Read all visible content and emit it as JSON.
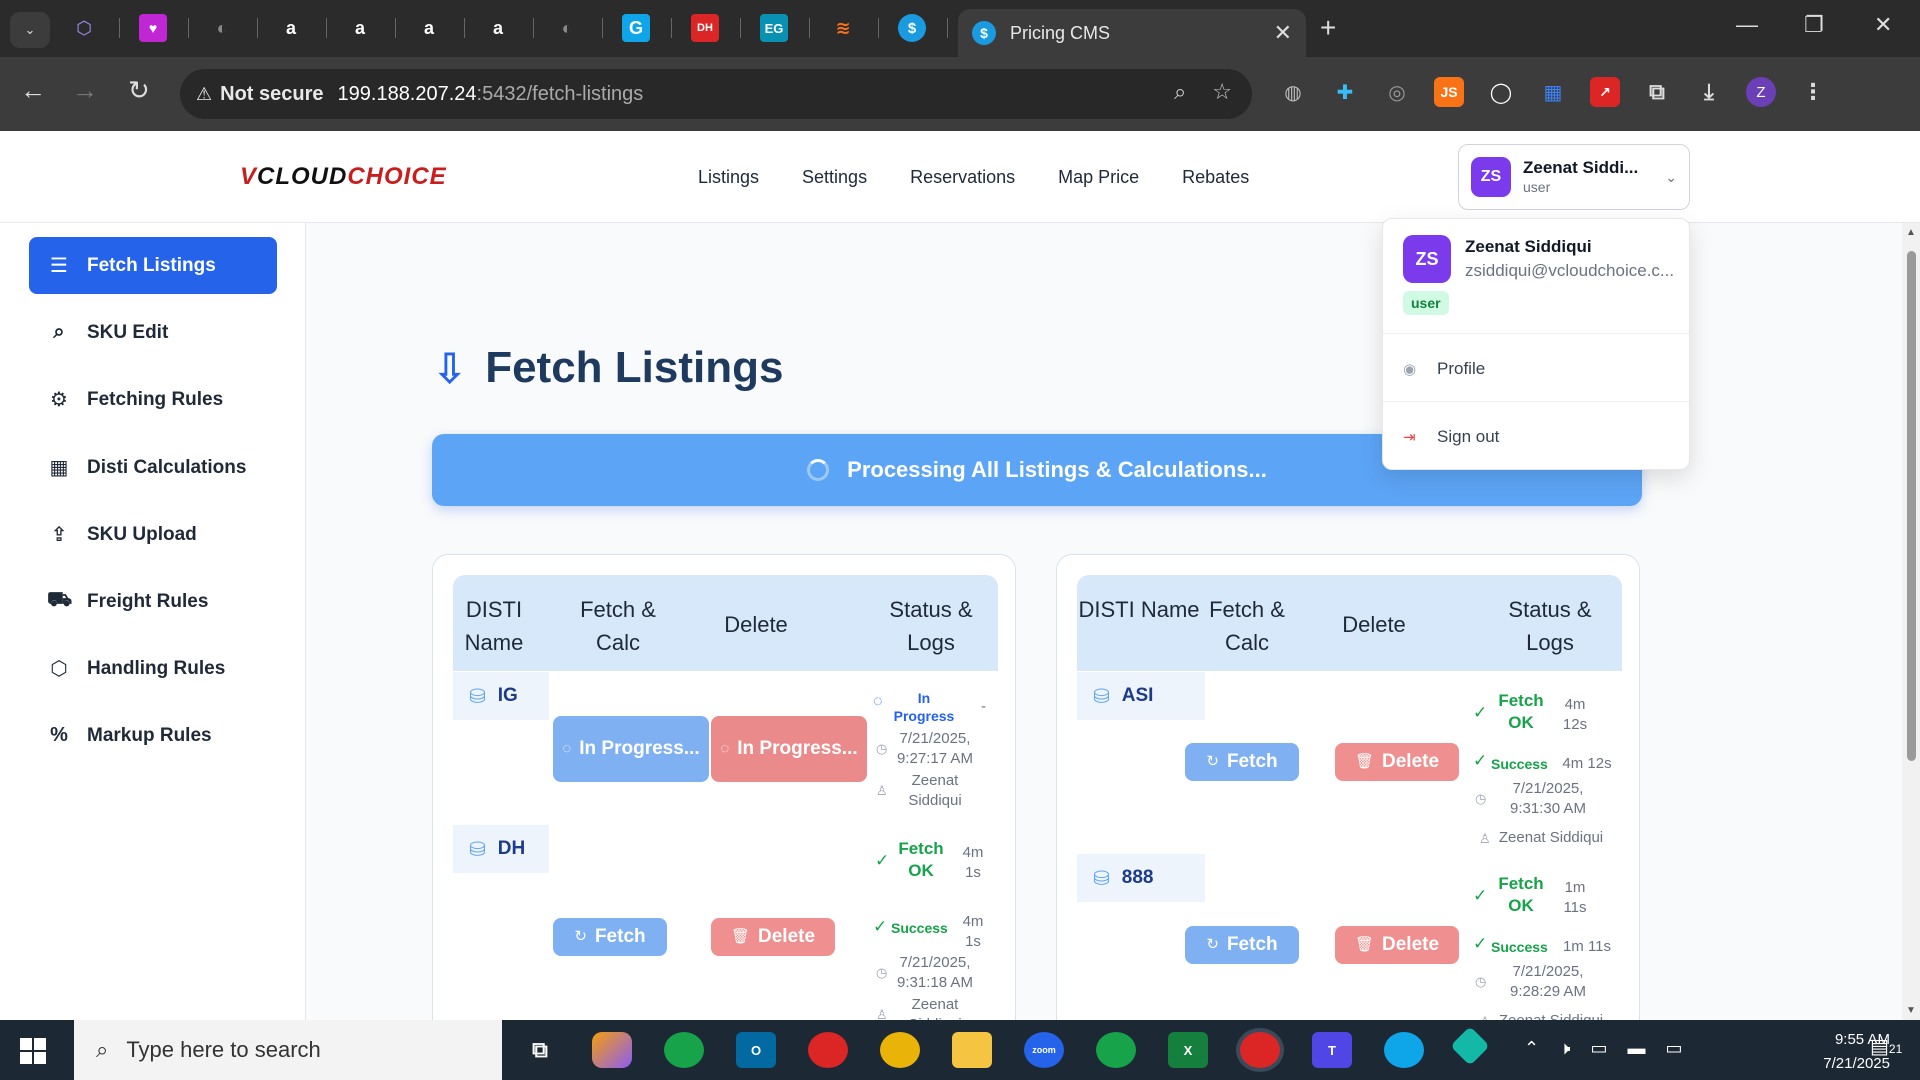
{
  "browser": {
    "pinned_tabs": [
      "⬡",
      "♥",
      "◐",
      "a",
      "a",
      "a",
      "a",
      "◐",
      "G",
      "DH",
      "EG",
      "≋",
      "$"
    ],
    "active_tab_title": "Pricing CMS",
    "active_tab_icon": "$",
    "new_tab": "+",
    "security_label": "Not secure",
    "url_host": "199.188.207.24",
    "url_path": ":5432/fetch-listings",
    "profile_initial": "Z",
    "extensions": [
      "◍",
      "✚",
      "◎",
      "JS",
      "◯",
      "▦",
      "↗",
      "⧉",
      "⤓"
    ]
  },
  "app": {
    "logo_v": "V",
    "logo_cloud": "CLOUD",
    "logo_choice": "CHOICE",
    "nav": [
      "Listings",
      "Settings",
      "Reservations",
      "Map Price",
      "Rebates"
    ],
    "user": {
      "initials": "ZS",
      "name_short": "Zeenat Siddi...",
      "role": "user",
      "name_full": "Zeenat Siddiqui",
      "email": "zsiddiqui@vcloudchoice.c...",
      "badge": "user"
    },
    "menu": {
      "profile": "Profile",
      "signout": "Sign out"
    }
  },
  "sidebar": [
    {
      "label": "Fetch Listings",
      "icon": "list-icon",
      "glyph": "☰"
    },
    {
      "label": "SKU Edit",
      "icon": "search-icon",
      "glyph": "⌕"
    },
    {
      "label": "Fetching Rules",
      "icon": "gear-icon",
      "glyph": "⚙"
    },
    {
      "label": "Disti Calculations",
      "icon": "calculator-icon",
      "glyph": "▦"
    },
    {
      "label": "SKU Upload",
      "icon": "upload-icon",
      "glyph": "⇪"
    },
    {
      "label": "Freight Rules",
      "icon": "truck-icon",
      "glyph": "⛟"
    },
    {
      "label": "Handling Rules",
      "icon": "package-icon",
      "glyph": "⬡"
    },
    {
      "label": "Markup Rules",
      "icon": "percent-icon",
      "glyph": "%"
    }
  ],
  "page": {
    "title": "Fetch Listings",
    "banner": "Processing All Listings & Calculations..."
  },
  "table_headers": {
    "disti": "DISTI Name",
    "fetch": "Fetch & Calc",
    "delete": "Delete",
    "status": "Status & Logs"
  },
  "left_panel": {
    "ig": {
      "name": "IG",
      "fetch_btn": "In Progress...",
      "delete_btn": "In Progress...",
      "status": "In Progress",
      "dash": "-",
      "time": "7/21/2025, 9:27:17 AM",
      "user": "Zeenat Siddiqui"
    },
    "dh": {
      "name": "DH",
      "fetch_status": "Fetch OK",
      "fetch_dur": "4m 1s",
      "fetch_btn": "Fetch",
      "delete_btn": "Delete",
      "calc_status": "Success",
      "calc_dur": "4m 1s",
      "time": "7/21/2025, 9:31:18 AM",
      "user": "Zeenat Siddiqui"
    }
  },
  "right_panel": {
    "asi": {
      "name": "ASI",
      "fetch_status": "Fetch OK",
      "fetch_dur": "4m 12s",
      "fetch_btn": "Fetch",
      "delete_btn": "Delete",
      "calc_status": "Success",
      "calc_dur": "4m 12s",
      "time": "7/21/2025, 9:31:30 AM",
      "user": "Zeenat Siddiqui"
    },
    "r888": {
      "name": "888",
      "fetch_status": "Fetch OK",
      "fetch_dur": "1m 11s",
      "fetch_btn": "Fetch",
      "delete_btn": "Delete",
      "calc_status": "Success",
      "calc_dur": "1m 11s",
      "time": "7/21/2025, 9:28:29 AM",
      "user": "Zeenat Siddiqui"
    }
  },
  "taskbar": {
    "search_placeholder": "Type here to search",
    "time": "9:55 AM",
    "date": "7/21/2025",
    "notif_count": "21"
  },
  "colors": {
    "primary": "#2563eb",
    "banner": "#5ca4f5",
    "success": "#16a34a",
    "delete": "#ef8f8f"
  }
}
